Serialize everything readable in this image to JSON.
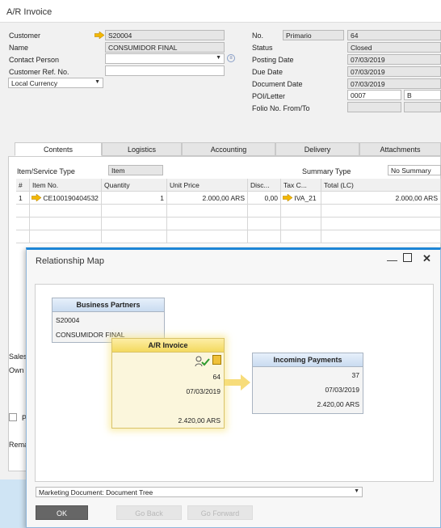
{
  "window": {
    "title": "A/R Invoice"
  },
  "header_left": {
    "customer_label": "Customer",
    "customer_value": "S20004",
    "name_label": "Name",
    "name_value": "CONSUMIDOR FINAL",
    "contact_label": "Contact Person",
    "contact_value": "",
    "ref_label": "Customer Ref. No.",
    "ref_value": "",
    "currency_value": "Local Currency"
  },
  "header_right": {
    "no_label": "No.",
    "series_value": "Primario",
    "no_value": "64",
    "status_label": "Status",
    "status_value": "Closed",
    "posting_label": "Posting Date",
    "posting_value": "07/03/2019",
    "due_label": "Due Date",
    "due_value": "07/03/2019",
    "docdate_label": "Document Date",
    "docdate_value": "07/03/2019",
    "poi_label": "POI/Letter",
    "poi_value": "0007",
    "letter_value": "B",
    "folio_label": "Folio No. From/To",
    "folio_from": "",
    "folio_to": ""
  },
  "tabs": [
    "Contents",
    "Logistics",
    "Accounting",
    "Delivery",
    "Attachments"
  ],
  "contents": {
    "item_type_label": "Item/Service Type",
    "item_type_value": "Item",
    "summary_label": "Summary Type",
    "summary_value": "No Summary",
    "columns": [
      "#",
      "Item No.",
      "Quantity",
      "Unit Price",
      "Disc...",
      "Tax C...",
      "Total (LC)"
    ],
    "rows": [
      {
        "num": "1",
        "item": "CE100190404532",
        "qty": "1",
        "price": "2.000,00 ARS",
        "disc": "0,00",
        "tax": "IVA_21",
        "total": "2.000,00 ARS"
      }
    ]
  },
  "footer_partial": {
    "sales_label": "Sales",
    "owner_label": "Own",
    "remarks_label": "Rema",
    "checkbox_label": "P"
  },
  "relationship_map": {
    "title": "Relationship Map",
    "business_partners": {
      "title": "Business Partners",
      "code": "S20004",
      "name": "CONSUMIDOR FINAL"
    },
    "invoice": {
      "title": "A/R Invoice",
      "number": "64",
      "date": "07/03/2019",
      "amount": "2.420,00 ARS"
    },
    "payments": {
      "title": "Incoming Payments",
      "number": "37",
      "date": "07/03/2019",
      "amount": "2.420,00 ARS"
    },
    "view_select": "Marketing Document: Document Tree",
    "ok_label": "OK",
    "back_label": "Go Back",
    "forward_label": "Go Forward"
  },
  "colors": {
    "accent_blue": "#1d86d6",
    "invoice_yellow": "#f7e27a",
    "link_arrow": "#f2c94c"
  }
}
